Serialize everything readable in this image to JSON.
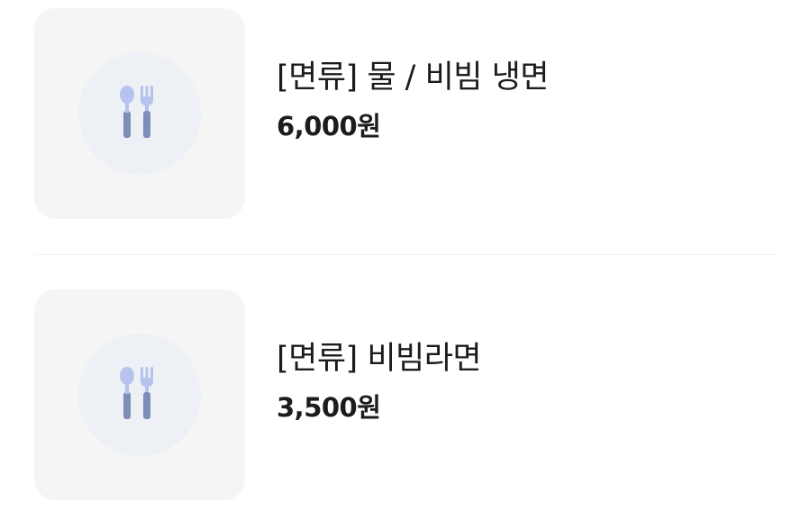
{
  "menu_items": [
    {
      "name": "[면류] 물 / 비빔 냉면",
      "price": "6,000원",
      "thumbnail_icon": "fork-spoon-icon"
    },
    {
      "name": "[면류] 비빔라면",
      "price": "3,500원",
      "thumbnail_icon": "fork-spoon-icon"
    }
  ],
  "colors": {
    "thumbnail_bg": "#f5f5f6",
    "icon_circle_bg": "#edf0f4",
    "icon_light": "#b6c3ef",
    "icon_dark": "#7f8eb9",
    "text": "#1c1c1c",
    "divider": "#f0f0f2"
  }
}
